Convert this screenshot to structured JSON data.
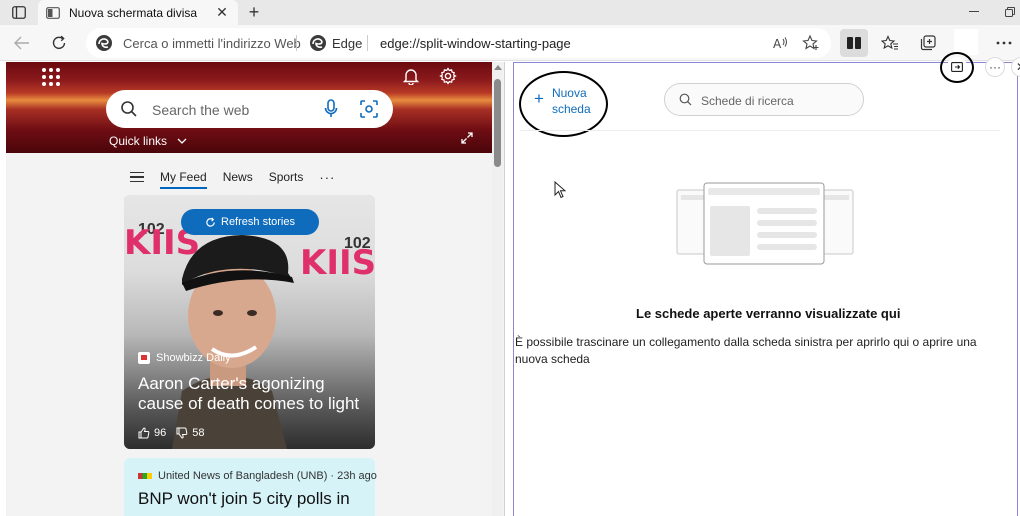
{
  "browser": {
    "tab": {
      "title": "Nuova schermata divisa"
    },
    "addressbar": {
      "placeholder": "Cerca o immetti l'indirizzo Web",
      "site_label": "Edge",
      "url": "edge://split-window-starting-page"
    }
  },
  "left_pane": {
    "search_placeholder": "Search the web",
    "quick_links_label": "Quick links",
    "feed_tabs": [
      "My Feed",
      "News",
      "Sports"
    ],
    "more_label": "···",
    "refresh_label": "Refresh stories",
    "card1": {
      "source": "Showbizz Daily",
      "title": "Aaron Carter's agonizing cause of death comes to light",
      "likes": "96",
      "dislikes": "58",
      "backdrop_text_left": "KIIS",
      "backdrop_text_right": "KIIS",
      "backdrop_num_left": "102",
      "backdrop_num_right": "102"
    },
    "card2": {
      "source": "United News of Bangladesh (UNB) · 23h ago",
      "title": "BNP won't join 5 city polls in"
    }
  },
  "right_pane": {
    "new_tab_line1": "Nuova",
    "new_tab_line2": "scheda",
    "search_tabs_placeholder": "Schede di ricerca",
    "empty_title": "Le schede aperte verranno visualizzate qui",
    "empty_desc": "È possibile trascinare un collegamento dalla scheda sinistra per aprirlo qui o aprire una nuova scheda",
    "more_label": "···",
    "close_label": "✕"
  },
  "colors": {
    "accent": "#0f6cbd",
    "split_border": "#8b86d6",
    "card2_bg": "#d6f3f7"
  }
}
